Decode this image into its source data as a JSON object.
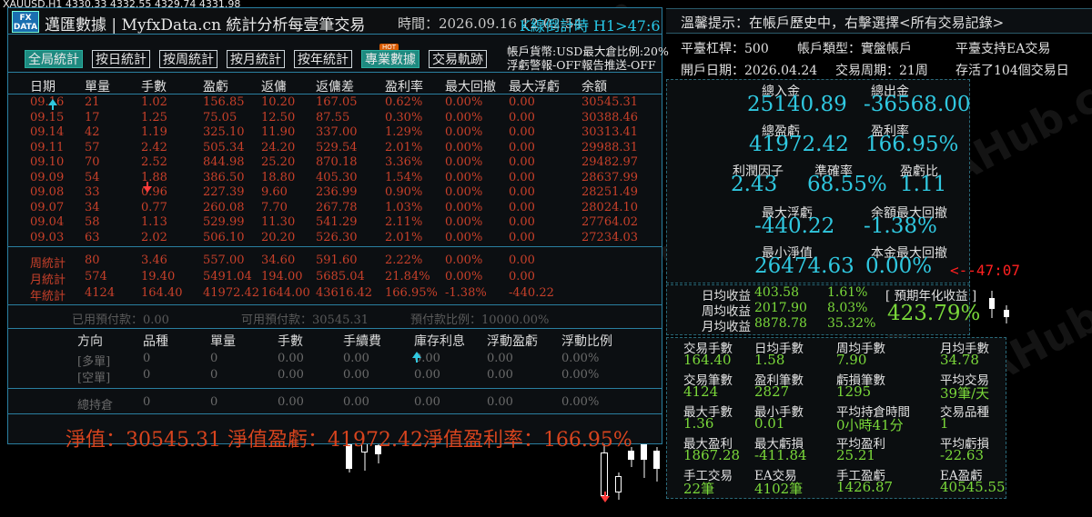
{
  "chart": {
    "symbol_line": "XAUUSD,H1  4330.33 4332.55 4329.74 4331.98"
  },
  "watermarks": [
    "EAHub.cn",
    "EAHub.cn",
    "EAHub.cn",
    "EAHub.cn",
    "EAHub.cn",
    "EAHub.cn",
    "EAHub.cn",
    "EAHub.cn",
    "EAHub.cn",
    "EAHub.cn"
  ],
  "main": {
    "logo_text": "FX\nDATA",
    "title": "邁匯數據 | MyfxData.cn  統計分析每壹筆交易",
    "date_label": "時間：2026.09.16 12:02:54",
    "countdown": "K線倒計時  H1>47:6",
    "tabs": [
      "全局統計",
      "按日統計",
      "按周統計",
      "按月統計",
      "按年統計",
      "專業數據",
      "交易軌跡"
    ],
    "active_tab": "專業數據",
    "hot_badge": "HOT",
    "account_line1": "帳戶貨幣:USD最大倉比例:20%",
    "account_line2": "浮虧警報-OFF報告推送-OFF",
    "headers": [
      "日期",
      "單量",
      "手數",
      "盈虧",
      "返傭",
      "返傭差",
      "盈利率",
      "最大回撤",
      "最大浮虧",
      "余額"
    ],
    "rows": [
      [
        "09.16",
        "21",
        "1.02",
        "156.85",
        "10.20",
        "167.05",
        "0.62%",
        "0.00%",
        "0.00",
        "30545.31"
      ],
      [
        "09.15",
        "17",
        "1.25",
        "75.05",
        "12.50",
        "87.55",
        "0.30%",
        "0.00%",
        "0.00",
        "30388.46"
      ],
      [
        "09.14",
        "42",
        "1.19",
        "325.10",
        "11.90",
        "337.00",
        "1.29%",
        "0.00%",
        "0.00",
        "30313.41"
      ],
      [
        "09.11",
        "57",
        "2.42",
        "505.34",
        "24.20",
        "529.54",
        "2.01%",
        "0.00%",
        "0.00",
        "29988.31"
      ],
      [
        "09.10",
        "70",
        "2.52",
        "844.98",
        "25.20",
        "870.18",
        "3.36%",
        "0.00%",
        "0.00",
        "29482.97"
      ],
      [
        "09.09",
        "54",
        "1.88",
        "386.50",
        "18.80",
        "405.30",
        "1.54%",
        "0.00%",
        "0.00",
        "28637.99"
      ],
      [
        "09.08",
        "33",
        "0.96",
        "227.39",
        "9.60",
        "236.99",
        "0.90%",
        "0.00%",
        "0.00",
        "28251.49"
      ],
      [
        "09.07",
        "34",
        "0.77",
        "260.08",
        "7.70",
        "267.78",
        "1.03%",
        "0.00%",
        "0.00",
        "28024.10"
      ],
      [
        "09.04",
        "58",
        "1.13",
        "529.99",
        "11.30",
        "541.29",
        "2.11%",
        "0.00%",
        "0.00",
        "27764.02"
      ],
      [
        "09.03",
        "63",
        "2.02",
        "506.10",
        "20.20",
        "526.30",
        "2.01%",
        "0.00%",
        "0.00",
        "27234.03"
      ]
    ],
    "summary": [
      [
        "周統計",
        "80",
        "3.46",
        "557.00",
        "34.60",
        "591.60",
        "2.22%",
        "0.00%",
        "0.00",
        ""
      ],
      [
        "月統計",
        "574",
        "19.40",
        "5491.04",
        "194.00",
        "5685.04",
        "21.84%",
        "0.00%",
        "0.00",
        ""
      ],
      [
        "年統計",
        "4124",
        "164.40",
        "41972.42",
        "1644.00",
        "43616.42",
        "166.95%",
        "-1.38%",
        "-440.22",
        ""
      ]
    ],
    "margin": {
      "used": "已用預付款：0.00",
      "available": "可用預付款：30545.31",
      "ratio": "預付款比例：10000.00%"
    },
    "pos_headers": [
      "方向",
      "品種",
      "單量",
      "手數",
      "手續費",
      "庫存利息",
      "浮動盈虧",
      "浮動比例"
    ],
    "positions": [
      [
        "[多單]",
        "0",
        "0",
        "0.00",
        "0.00",
        "0.00",
        "0.00",
        "0.00%"
      ],
      [
        "[空單]",
        "0",
        "0",
        "0.00",
        "0.00",
        "0.00",
        "0.00",
        "0.00%"
      ]
    ],
    "total_position": [
      "總持倉",
      "0",
      "0",
      "0.00",
      "0.00",
      "0.00",
      "0.00",
      "0.00%"
    ],
    "equity_line": "淨值：30545.31    淨值盈虧：41972.42淨值盈利率：166.95%"
  },
  "right": {
    "tip": "溫馨提示：在帳戶歷史中，右擊選擇<所有交易記錄>",
    "info1": [
      "平臺杠桿：500",
      "帳戶類型：實盤帳戶",
      "平臺支持EA交易"
    ],
    "info2": [
      "開戶日期：2026.04.24",
      "交易周期：21周",
      "存活了104個交易日"
    ],
    "box1": {
      "deposit_label": "總入金",
      "deposit": "25140.89",
      "withdraw_label": "總出金",
      "withdraw": "-36568.00",
      "profit_label": "總盈虧",
      "profit": "41972.42",
      "rate_label": "盈利率",
      "rate": "166.95%",
      "pf_label": "利潤因子",
      "pf": "2.43",
      "acc_label": "準確率",
      "acc": "68.55%",
      "pl_label": "盈虧比",
      "pl": "1.11",
      "maxfloat_label": "最大浮虧",
      "maxfloat": "-440.22",
      "baldd_label": "余額最大回撤",
      "baldd": "-1.38%",
      "minequity_label": "最小淨值",
      "minequity": "26474.63",
      "capdd_label": "本金最大回撤",
      "capdd": "0.00%"
    },
    "countdown_red": "<--47:07",
    "returns": {
      "daily_label": "日均收益",
      "daily": "403.58",
      "daily_pct": "1.61%",
      "weekly_label": "周均收益",
      "weekly": "2017.90",
      "weekly_pct": "8.03%",
      "monthly_label": "月均收益",
      "monthly": "8878.78",
      "monthly_pct": "35.32%",
      "annual_label": "[ 預期年化收益 ]",
      "annual": "423.79%"
    },
    "stats": [
      {
        "label": "交易手數",
        "value": "164.40"
      },
      {
        "label": "日均手數",
        "value": "1.58"
      },
      {
        "label": "周均手數",
        "value": "7.90"
      },
      {
        "label": "月均手數",
        "value": "34.78"
      },
      {
        "label": "交易筆數",
        "value": "4124"
      },
      {
        "label": "盈利筆數",
        "value": "2827"
      },
      {
        "label": "虧損筆數",
        "value": "1295"
      },
      {
        "label": "平均交易",
        "value": "39筆/天"
      },
      {
        "label": "最大手數",
        "value": "1.36"
      },
      {
        "label": "最小手數",
        "value": "0.01"
      },
      {
        "label": "平均持倉時間",
        "value": "0小時41分"
      },
      {
        "label": "交易品種",
        "value": "1"
      },
      {
        "label": "最大盈利",
        "value": "1867.28"
      },
      {
        "label": "最大虧損",
        "value": "-411.84"
      },
      {
        "label": "平均盈利",
        "value": "25.21"
      },
      {
        "label": "平均虧損",
        "value": "-22.63"
      },
      {
        "label": "手工交易",
        "value": "22筆"
      },
      {
        "label": "EA交易",
        "value": "4102筆"
      },
      {
        "label": "手工盈虧",
        "value": "1426.87"
      },
      {
        "label": "EA盈虧",
        "value": "40545.55"
      }
    ]
  }
}
